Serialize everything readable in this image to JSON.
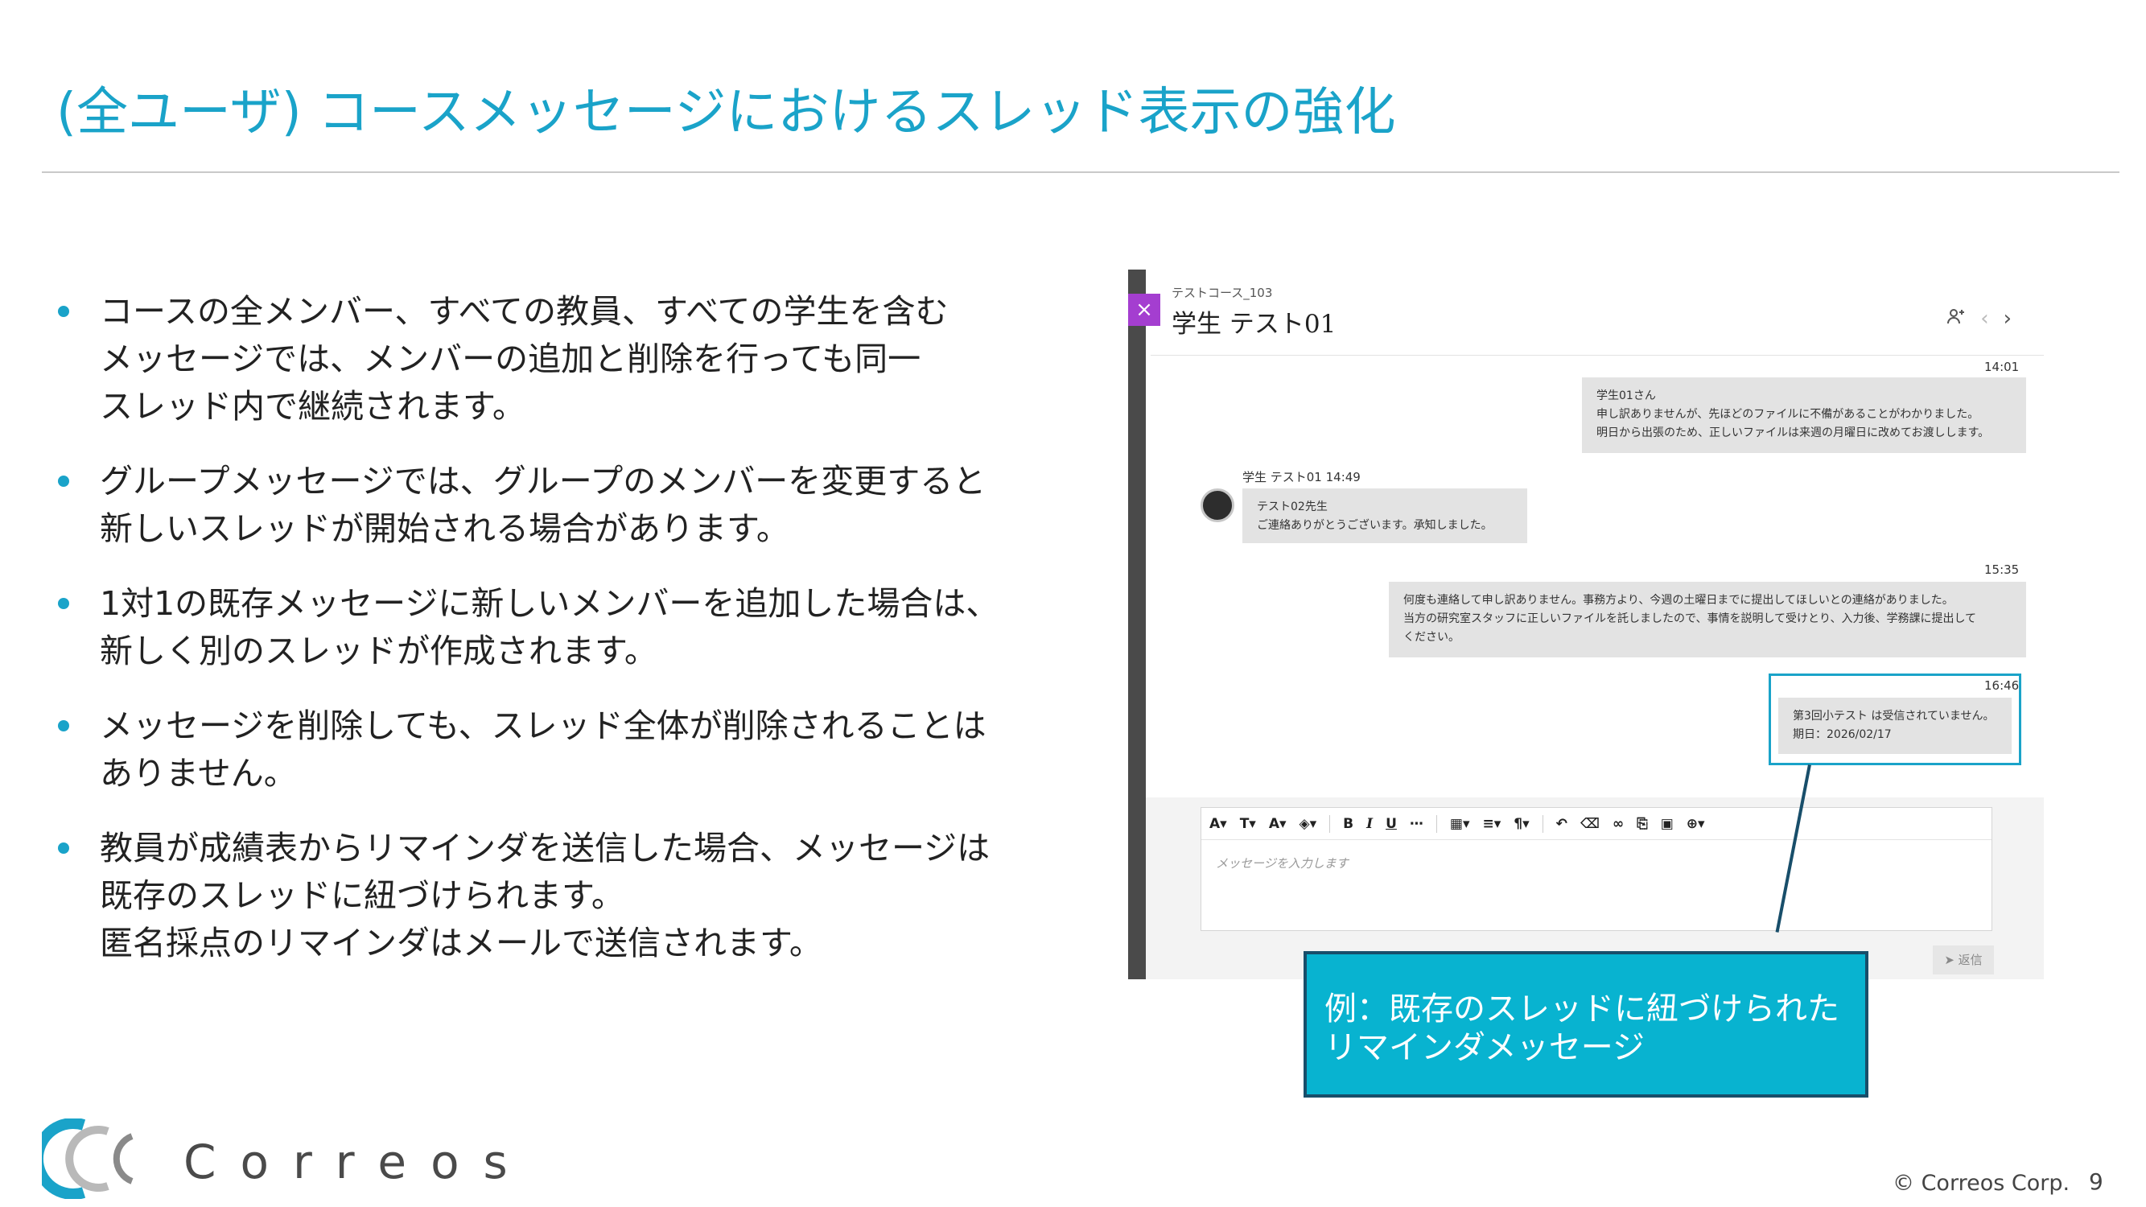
{
  "slide": {
    "title": "(全ユーザ) コースメッセージにおけるスレッド表示の強化",
    "bullets": [
      {
        "lines": [
          "コースの全メンバー、すべての教員、すべての学生を含む",
          "メッセージでは、メンバーの追加と削除を行っても同一",
          "スレッド内で継続されます。"
        ]
      },
      {
        "lines": [
          "グループメッセージでは、グループのメンバーを変更すると",
          "新しいスレッドが開始される場合があります。"
        ]
      },
      {
        "lines": [
          "1対1の既存メッセージに新しいメンバーを追加した場合は、",
          "新しく別のスレッドが作成されます。"
        ]
      },
      {
        "lines": [
          "メッセージを削除しても、スレッド全体が削除されることは",
          "ありません。"
        ]
      },
      {
        "lines": [
          "教員が成績表からリマインダを送信した場合、メッセージは",
          "既存のスレッドに紐づけられます。",
          "匿名採点のリマインダはメールで送信されます。"
        ]
      }
    ],
    "callout": {
      "lines": [
        "例：既存のスレッドに紐づけられた",
        "リマインダメッセージ"
      ]
    },
    "footer": {
      "copyright": "© Correos Corp.",
      "page": "9"
    },
    "logo_text": "Correos"
  },
  "screenshot": {
    "close_glyph": "×",
    "course_name": "テストコース_103",
    "student_name": "学生 テスト01",
    "messages": [
      {
        "time": "14:01",
        "lines": [
          "学生01さん",
          "申し訳ありませんが、先ほどのファイルに不備があることがわかりました。",
          "明日から出張のため、正しいファイルは来週の月曜日に改めてお渡しします。"
        ]
      },
      {
        "sender": "学生 テスト01  14:49",
        "lines": [
          "テスト02先生",
          "ご連絡ありがとうございます。承知しました。"
        ]
      },
      {
        "time": "15:35",
        "lines": [
          "何度も連絡して申し訳ありません。事務方より、今週の土曜日までに提出してほしいとの連絡がありました。",
          "当方の研究室スタッフに正しいファイルを託しましたので、事情を説明して受けとり、入力後、学務課に提出して",
          "ください。"
        ]
      },
      {
        "time": "16:46",
        "lines": [
          "第3回小テスト は受信されていません。",
          "期日：2026/02/17"
        ]
      }
    ],
    "composer": {
      "placeholder": "メッセージを入力します",
      "send_label": "返信",
      "toolbar": [
        "A▾",
        "T▾",
        "A▾",
        "◈▾",
        "B",
        "I",
        "U",
        "⋯",
        "▦▾",
        "≡▾",
        "¶▾",
        "↶",
        "⌫",
        "∞",
        "⎘",
        "▣",
        "⊕▾"
      ]
    },
    "icons": {
      "add_member": "add-member-icon",
      "prev": "chevron-left-icon",
      "next": "chevron-right-icon",
      "send": "send-icon"
    }
  }
}
